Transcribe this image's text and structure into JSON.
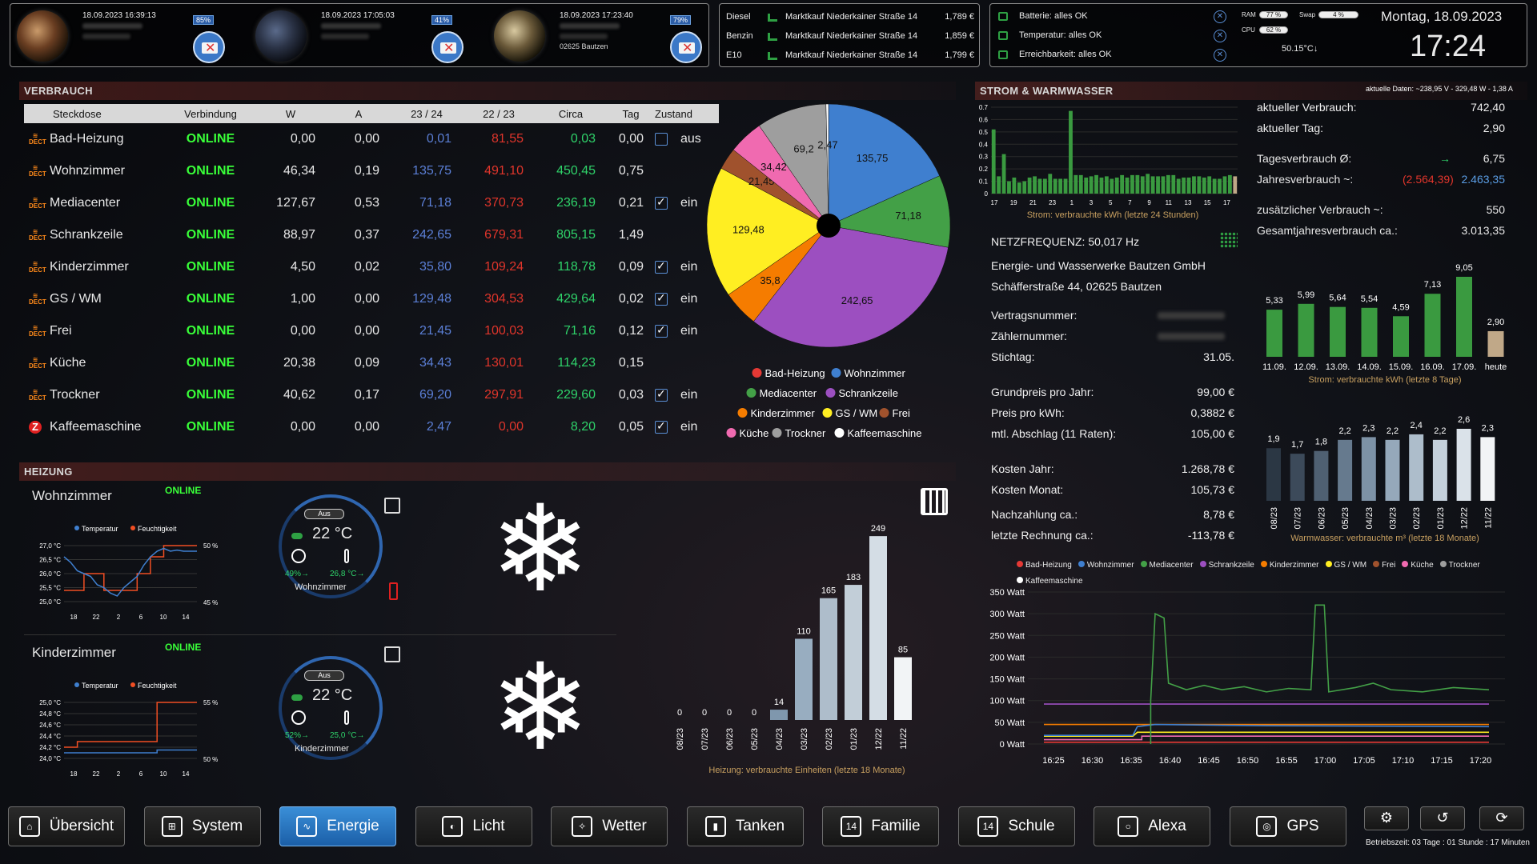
{
  "mails": [
    {
      "datetime": "18.09.2023 16:39:13",
      "subline": "",
      "percent": "85%"
    },
    {
      "datetime": "18.09.2023 17:05:03",
      "subline": "",
      "percent": "41%"
    },
    {
      "datetime": "18.09.2023 17:23:40",
      "subline": "02625 Bautzen",
      "percent": "79%"
    }
  ],
  "fuel": [
    {
      "type": "Diesel",
      "station": "Marktkauf Niederkainer Straße 14",
      "price": "1,789 €"
    },
    {
      "type": "Benzin",
      "station": "Marktkauf Niederkainer Straße 14",
      "price": "1,859 €"
    },
    {
      "type": "E10",
      "station": "Marktkauf Niederkainer Straße 14",
      "price": "1,799 €"
    }
  ],
  "status": {
    "items": [
      "Batterie: alles OK",
      "Temperatur: alles OK",
      "Erreichbarkeit: alles OK"
    ],
    "ram_label": "RAM",
    "ram_value": "77 %",
    "swap_label": "Swap",
    "swap_value": "4 %",
    "cpu_label": "CPU",
    "cpu_value": "62 %",
    "cpu_temp": "50.15°C↓"
  },
  "clock": {
    "date": "Montag, 18.09.2023",
    "time": "17:24"
  },
  "verbrauch": {
    "title": "Verbrauch",
    "headers": [
      "Steckdose",
      "Verbindung",
      "W",
      "A",
      "23 / 24",
      "22 / 23",
      "Circa",
      "Tag",
      "Zustand"
    ],
    "rows": [
      {
        "name": "Bad-Heizung",
        "conn": "ONLINE",
        "w": "0,00",
        "a": "0,00",
        "y1": "0,01",
        "y2": "81,55",
        "circa": "0,03",
        "tag": "0,00",
        "checked": false,
        "state": "aus",
        "icon": "dect"
      },
      {
        "name": "Wohnzimmer",
        "conn": "ONLINE",
        "w": "46,34",
        "a": "0,19",
        "y1": "135,75",
        "y2": "491,10",
        "circa": "450,45",
        "tag": "0,75",
        "checked": null,
        "state": "",
        "icon": "dect"
      },
      {
        "name": "Mediacenter",
        "conn": "ONLINE",
        "w": "127,67",
        "a": "0,53",
        "y1": "71,18",
        "y2": "370,73",
        "circa": "236,19",
        "tag": "0,21",
        "checked": true,
        "state": "ein",
        "icon": "dect"
      },
      {
        "name": "Schrankzeile",
        "conn": "ONLINE",
        "w": "88,97",
        "a": "0,37",
        "y1": "242,65",
        "y2": "679,31",
        "circa": "805,15",
        "tag": "1,49",
        "checked": null,
        "state": "",
        "icon": "dect"
      },
      {
        "name": "Kinderzimmer",
        "conn": "ONLINE",
        "w": "4,50",
        "a": "0,02",
        "y1": "35,80",
        "y2": "109,24",
        "circa": "118,78",
        "tag": "0,09",
        "checked": true,
        "state": "ein",
        "icon": "dect"
      },
      {
        "name": "GS / WM",
        "conn": "ONLINE",
        "w": "1,00",
        "a": "0,00",
        "y1": "129,48",
        "y2": "304,53",
        "circa": "429,64",
        "tag": "0,02",
        "checked": true,
        "state": "ein",
        "icon": "dect"
      },
      {
        "name": "Frei",
        "conn": "ONLINE",
        "w": "0,00",
        "a": "0,00",
        "y1": "21,45",
        "y2": "100,03",
        "circa": "71,16",
        "tag": "0,12",
        "checked": true,
        "state": "ein",
        "icon": "dect"
      },
      {
        "name": "Küche",
        "conn": "ONLINE",
        "w": "20,38",
        "a": "0,09",
        "y1": "34,43",
        "y2": "130,01",
        "circa": "114,23",
        "tag": "0,15",
        "checked": null,
        "state": "",
        "icon": "dect"
      },
      {
        "name": "Trockner",
        "conn": "ONLINE",
        "w": "40,62",
        "a": "0,17",
        "y1": "69,20",
        "y2": "297,91",
        "circa": "229,60",
        "tag": "0,03",
        "checked": true,
        "state": "ein",
        "icon": "dect"
      },
      {
        "name": "Kaffeemaschine",
        "conn": "ONLINE",
        "w": "0,00",
        "a": "0,00",
        "y1": "2,47",
        "y2": "0,00",
        "circa": "8,20",
        "tag": "0,05",
        "checked": true,
        "state": "ein",
        "icon": "z"
      }
    ]
  },
  "pie": {
    "slices": [
      {
        "name": "Bad-Heizung",
        "value": 0.01,
        "label": "",
        "color": "#e53935"
      },
      {
        "name": "Wohnzimmer",
        "value": 135.75,
        "label": "135,75",
        "color": "#3f7fcf"
      },
      {
        "name": "Mediacenter",
        "value": 71.18,
        "label": "71,18",
        "color": "#43a047"
      },
      {
        "name": "Schrankzeile",
        "value": 242.65,
        "label": "242,65",
        "color": "#9c4fc0"
      },
      {
        "name": "Kinderzimmer",
        "value": 35.8,
        "label": "35,8",
        "color": "#f57c00"
      },
      {
        "name": "GS / WM",
        "value": 129.48,
        "label": "129,48",
        "color": "#ffee22"
      },
      {
        "name": "Frei",
        "value": 21.45,
        "label": "21,45",
        "color": "#a0522d"
      },
      {
        "name": "Küche",
        "value": 34.43,
        "label": "34,42",
        "color": "#f06ab0"
      },
      {
        "name": "Trockner",
        "value": 69.2,
        "label": "69,2",
        "color": "#9e9e9e"
      },
      {
        "name": "Kaffeemaschine",
        "value": 2.47,
        "label": "2,47",
        "color": "#ffffff"
      }
    ]
  },
  "strom": {
    "title": "Strom & Warmwasser",
    "aktuelle_daten": "aktuelle Daten: ~238,95 V - 329,48 W - 1,38 A",
    "hourly": {
      "caption": "Strom: verbrauchte kWh (letzte 24 Stunden)",
      "yticks": [
        "0.7",
        "0.6",
        "0.5",
        "0.4",
        "0.3",
        "0.2",
        "0.1",
        "0"
      ],
      "xticks": [
        "17",
        "19",
        "21",
        "23",
        "1",
        "3",
        "5",
        "7",
        "9",
        "11",
        "13",
        "15",
        "17"
      ],
      "values": [
        0.52,
        0.14,
        0.32,
        0.1,
        0.13,
        0.09,
        0.1,
        0.13,
        0.14,
        0.12,
        0.12,
        0.16,
        0.12,
        0.12,
        0.12,
        0.67,
        0.15,
        0.15,
        0.13,
        0.14,
        0.15,
        0.13,
        0.14,
        0.12,
        0.13,
        0.15,
        0.13,
        0.15,
        0.15,
        0.14,
        0.16,
        0.14,
        0.14,
        0.14,
        0.15,
        0.15,
        0.12,
        0.13,
        0.13,
        0.14,
        0.14,
        0.13,
        0.14,
        0.12,
        0.12,
        0.14,
        0.15,
        0.14
      ]
    },
    "netzfrequenz": "NETZFREQUENZ: 50,017 Hz",
    "provider_name": "Energie- und Wasserwerke Bautzen GmbH",
    "provider_addr": "Schäfferstraße 44, 02625 Bautzen",
    "contract": [
      {
        "label": "Vertragsnummer:",
        "value": ""
      },
      {
        "label": "Zählernummer:",
        "value": ""
      },
      {
        "label": "Stichtag:",
        "value": "31.05."
      }
    ],
    "prices": [
      {
        "label": "Grundpreis pro Jahr:",
        "value": "99,00 €"
      },
      {
        "label": "Preis pro kWh:",
        "value": "0,3882 €"
      },
      {
        "label": "mtl. Abschlag (11 Raten):",
        "value": "105,00 €"
      }
    ],
    "costs": [
      {
        "label": "Kosten Jahr:",
        "value": "1.268,78 €"
      },
      {
        "label": "Kosten Monat:",
        "value": "105,73 €"
      },
      {
        "label": "Nachzahlung ca.:",
        "value": "8,78 €"
      },
      {
        "label": "letzte Rechnung ca.:",
        "value": "-113,78 €"
      }
    ],
    "aktuell": [
      {
        "label": "aktueller Verbrauch:",
        "value": "742,40"
      },
      {
        "label": "aktueller Tag:",
        "value": "2,90"
      }
    ],
    "tages_label": "Tagesverbrauch Ø:",
    "tages_arrow": "→",
    "tages_value": "6,75",
    "jahres_label": "Jahresverbrauch ~:",
    "jahres_red": "(2.564,39)",
    "jahres_blue": "2.463,35",
    "zusatz_label": "zusätzlicher Verbrauch ~:",
    "zusatz_value": "550",
    "gesamt_label": "Gesamtjahresverbrauch ca.:",
    "gesamt_value": "3.013,35",
    "daily": {
      "caption": "Strom: verbrauchte kWh (letzte 8 Tage)",
      "categories": [
        "11.09.",
        "12.09.",
        "13.09.",
        "14.09.",
        "15.09.",
        "16.09.",
        "17.09.",
        "heute"
      ],
      "values": [
        5.33,
        5.99,
        5.64,
        5.54,
        4.59,
        7.13,
        9.05,
        2.9
      ],
      "labels": [
        "5,33",
        "5,99",
        "5,64",
        "5,54",
        "4,59",
        "7,13",
        "9,05",
        "2,90"
      ]
    },
    "water": {
      "caption": "Warmwasser: verbrauchte m³ (letzte 18 Monate)",
      "categories": [
        "08/23",
        "07/23",
        "06/23",
        "05/23",
        "04/23",
        "03/23",
        "02/23",
        "01/23",
        "12/22",
        "11/22"
      ],
      "values": [
        1.9,
        1.7,
        1.8,
        2.2,
        2.3,
        2.2,
        2.4,
        2.2,
        2.6,
        2.3
      ],
      "labels": [
        "1,9",
        "1,7",
        "1,8",
        "2,2",
        "2,3",
        "2,2",
        "2,4",
        "2,2",
        "2,6",
        "2,3"
      ]
    },
    "line": {
      "legend": [
        "Bad-Heizung",
        "Wohnzimmer",
        "Mediacenter",
        "Schrankzeile",
        "Kinderzimmer",
        "GS / WM",
        "Frei",
        "Küche",
        "Trockner",
        "Kaffeemaschine"
      ],
      "yticks": [
        "350 Watt",
        "300 Watt",
        "250 Watt",
        "200 Watt",
        "150 Watt",
        "100 Watt",
        "50 Watt",
        "0 Watt"
      ],
      "xticks": [
        "16:25",
        "16:30",
        "16:35",
        "16:40",
        "16:45",
        "16:50",
        "16:55",
        "17:00",
        "17:05",
        "17:10",
        "17:15",
        "17:20"
      ]
    }
  },
  "heizung": {
    "title": "Heizung",
    "rooms": [
      {
        "name": "Wohnzimmer",
        "status": "ONLINE",
        "legend_t": "Temperatur",
        "legend_h": "Feuchtigkeit",
        "yticks": [
          "27,0 °C",
          "26,5 °C",
          "26,0 °C",
          "25,5 °C",
          "25,0 °C"
        ],
        "rticks": [
          "50 %",
          "45 %"
        ],
        "xticks": [
          "18",
          "22",
          "2",
          "6",
          "10",
          "14"
        ],
        "mode": "Aus",
        "temp": "22 °C",
        "hum": "49%→",
        "cur": "26,8 °C→",
        "label": "Wohnzimmer"
      },
      {
        "name": "Kinderzimmer",
        "status": "ONLINE",
        "legend_t": "Temperatur",
        "legend_h": "Feuchtigkeit",
        "yticks": [
          "25,0 °C",
          "24,8 °C",
          "24,6 °C",
          "24,4 °C",
          "24,2 °C",
          "24,0 °C"
        ],
        "rticks": [
          "55 %",
          "50 %"
        ],
        "xticks": [
          "18",
          "22",
          "2",
          "6",
          "10",
          "14"
        ],
        "mode": "Aus",
        "temp": "22 °C",
        "hum": "52%→",
        "cur": "25,0 °C→",
        "label": "Kinderzimmer"
      }
    ],
    "chart": {
      "caption": "Heizung: verbrauchte Einheiten (letzte 18 Monate)",
      "categories": [
        "08/23",
        "07/23",
        "06/23",
        "05/23",
        "04/23",
        "03/23",
        "02/23",
        "01/23",
        "12/22",
        "11/22"
      ],
      "values": [
        0,
        0,
        0,
        0,
        14,
        110,
        165,
        183,
        249,
        85
      ]
    }
  },
  "nav": [
    {
      "label": "Übersicht",
      "icon": "home-icon",
      "active": false
    },
    {
      "label": "System",
      "icon": "network-icon",
      "active": false
    },
    {
      "label": "Energie",
      "icon": "energy-icon",
      "active": true
    },
    {
      "label": "Licht",
      "icon": "light-icon",
      "active": false
    },
    {
      "label": "Wetter",
      "icon": "weather-icon",
      "active": false
    },
    {
      "label": "Tanken",
      "icon": "fuel-icon",
      "active": false
    },
    {
      "label": "Familie",
      "icon": "calendar-icon",
      "active": false
    },
    {
      "label": "Schule",
      "icon": "calendar-icon",
      "active": false
    },
    {
      "label": "Alexa",
      "icon": "alexa-icon",
      "active": false
    },
    {
      "label": "GPS",
      "icon": "gps-icon",
      "active": false
    }
  ],
  "uptime": "Betriebszeit: 03 Tage : 01 Stunde : 17 Minuten"
}
